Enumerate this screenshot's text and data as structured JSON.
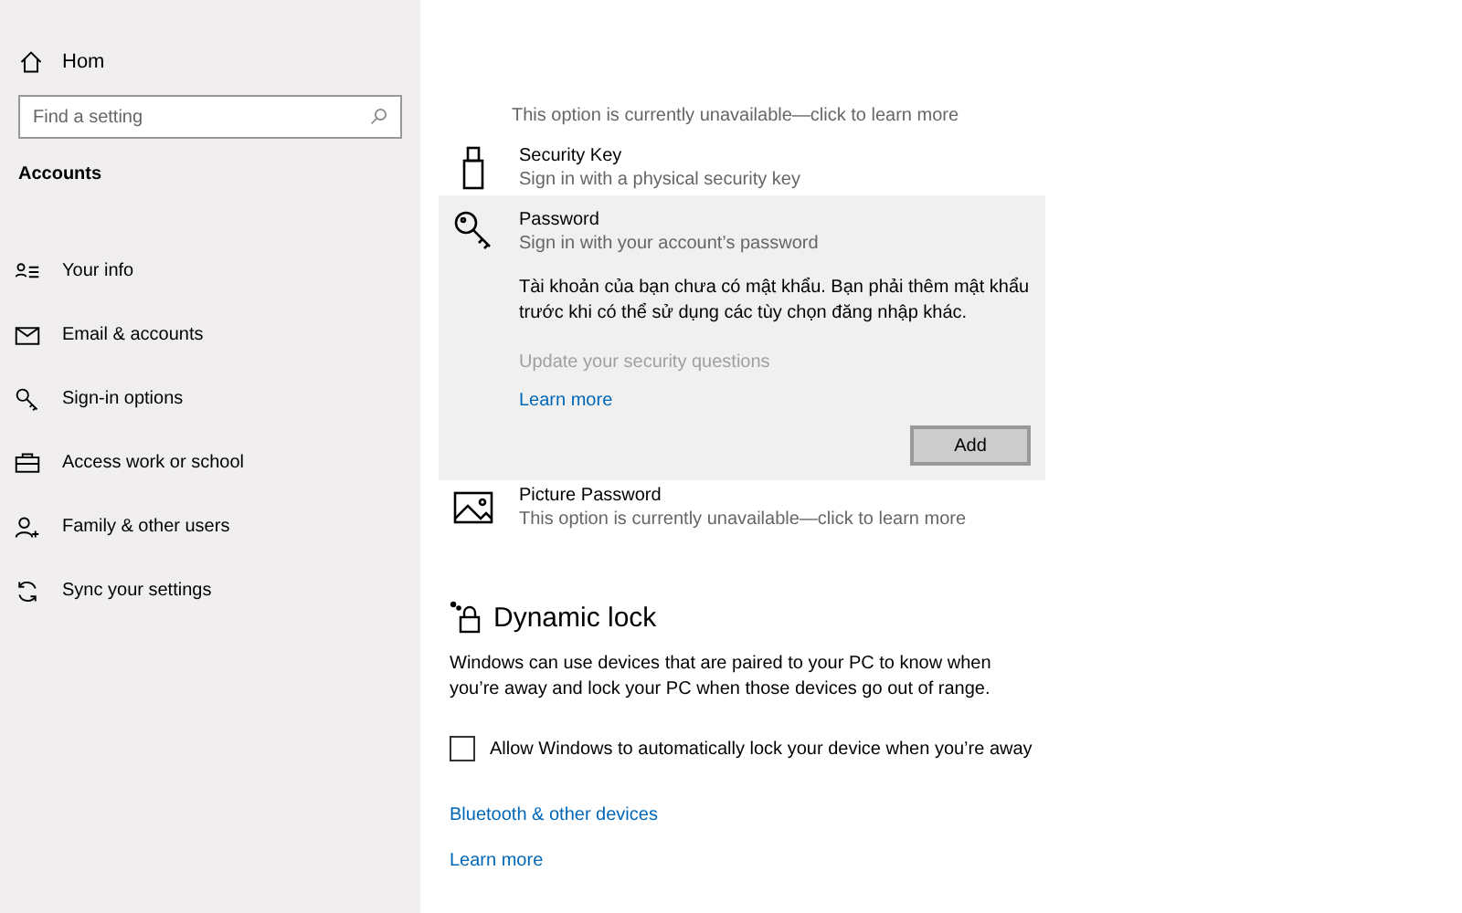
{
  "sidebar": {
    "home": "Hom",
    "search": {
      "placeholder": "Find a setting"
    },
    "section": "Accounts",
    "items": [
      {
        "label": "Your info"
      },
      {
        "label": "Email & accounts"
      },
      {
        "label": "Sign-in options"
      },
      {
        "label": "Access work or school"
      },
      {
        "label": "Family & other users"
      },
      {
        "label": "Sync your settings"
      }
    ]
  },
  "main": {
    "top_note": "This option is currently unavailable—click to learn more",
    "options": [
      {
        "title": "Security Key",
        "subtitle": "Sign in with a physical security key",
        "expanded": false
      },
      {
        "title": "Password",
        "subtitle": "Sign in with your account’s password",
        "expanded": true,
        "message": "Tài khoản của bạn chưa có mật khẩu. Bạn phải thêm mật khẩu trước khi có thể sử dụng các tùy chọn đăng nhập khác.",
        "disabled_link": "Update your security questions",
        "link": "Learn more",
        "button": "Add"
      },
      {
        "title": "Picture Password",
        "subtitle": "This option is currently unavailable—click to learn more",
        "expanded": false
      }
    ],
    "dynamic_lock": {
      "heading": "Dynamic lock",
      "description": "Windows can use devices that are paired to your PC to know when you’re away and lock your PC when those devices go out of range.",
      "checkbox": {
        "label": "Allow Windows to automatically lock your device when you’re away",
        "checked": false
      },
      "links": [
        "Bluetooth & other devices",
        "Learn more"
      ]
    }
  }
}
